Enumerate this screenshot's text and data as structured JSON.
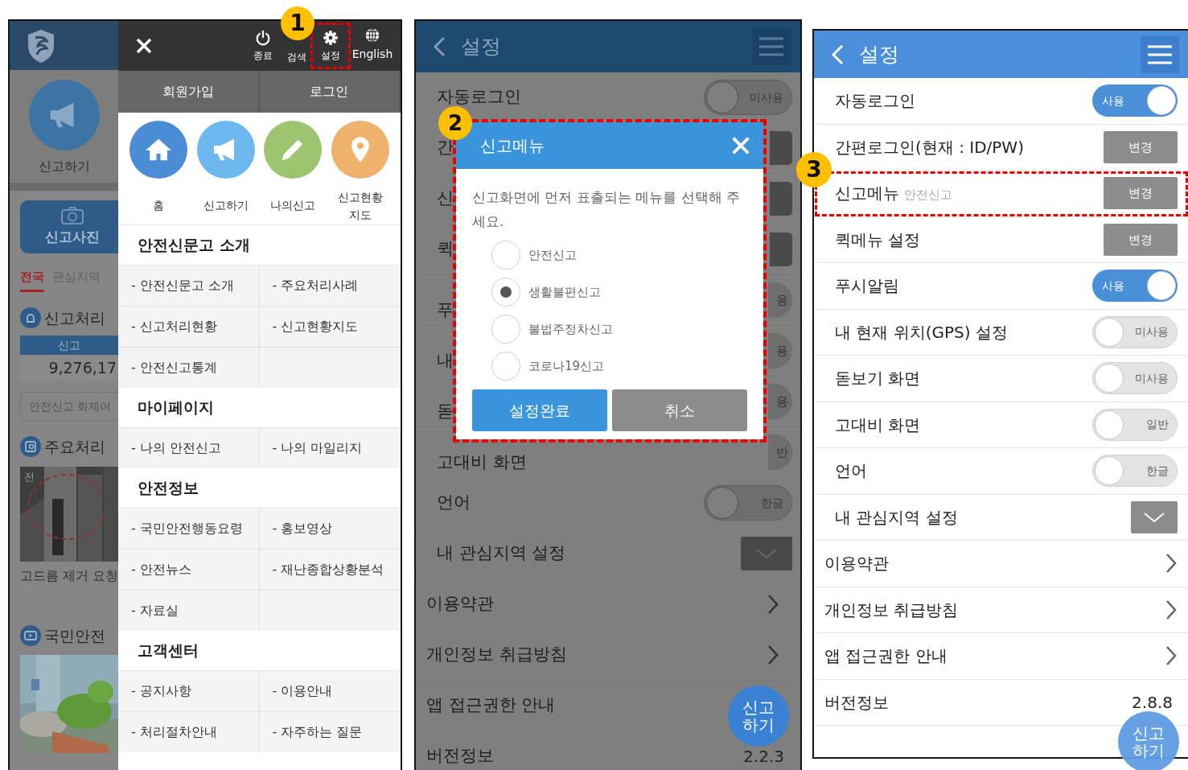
{
  "screen_1": {
    "callout": "1",
    "page": {
      "report_label": "신고하기",
      "photo_button": "신고사진",
      "region_tabs": [
        {
          "label": "전국",
          "selected": true
        },
        {
          "label": "관심지역",
          "selected": false
        }
      ],
      "status_title": "신고처리",
      "status_header": "신고",
      "status_count": "9,276,17",
      "keyword_box": "안전신고 화제어",
      "cases_title": "주요처리",
      "case_tag": "전",
      "case_caption": "고드름 제거 요청",
      "video_title": "국민안전"
    },
    "drawer": {
      "actions": [
        {
          "kind": "power",
          "label": "종료",
          "highlighted": false,
          "covered": false
        },
        {
          "kind": "search",
          "label": "검색",
          "highlighted": false,
          "covered": true
        },
        {
          "kind": "gear",
          "label": "설정",
          "highlighted": true,
          "covered": false
        },
        {
          "kind": "globe",
          "label": "English",
          "highlighted": false,
          "covered": false
        }
      ],
      "account_tabs": [
        "회원가입",
        "로그인"
      ],
      "shortcuts": [
        {
          "kind": "home",
          "label": "홈",
          "color": "#4a8dd6"
        },
        {
          "kind": "megaphone",
          "label": "신고하기",
          "color": "#6db8ee"
        },
        {
          "kind": "pencil",
          "label": "나의신고",
          "color": "#9dc56f"
        },
        {
          "kind": "pin",
          "label": "신고현황 지도",
          "color": "#eeb26c"
        }
      ],
      "sections": [
        {
          "title": "안전신문고 소개",
          "items": [
            "- 안전신문고 소개",
            "- 주요처리사례",
            "- 신고처리현황",
            "- 신고현황지도",
            "- 안전신고통계"
          ]
        },
        {
          "title": "마이페이지",
          "items": [
            "- 나의 안전신고",
            "- 나의 마일리지"
          ]
        },
        {
          "title": "안전정보",
          "items": [
            "- 국민안전행동요령",
            "- 홍보영상",
            "- 안전뉴스",
            "- 재난종합상황분석",
            "- 자료실"
          ]
        },
        {
          "title": "고객센터",
          "items": [
            "- 공지사항",
            "- 이용안내",
            "- 처리절차안내",
            "- 자주하는 질문"
          ]
        }
      ]
    }
  },
  "screen_2": {
    "callout": "2",
    "title": "설정",
    "rows": [
      {
        "label": "자동로그인",
        "kind": "toggle",
        "on": false,
        "value": "미사용"
      },
      {
        "label": "간",
        "kind": "covered_button"
      },
      {
        "label": "신",
        "kind": "covered_button"
      },
      {
        "label": "퀵",
        "kind": "covered_button"
      },
      {
        "label": "푸",
        "kind": "covered_toggle",
        "value": "용"
      },
      {
        "label": "내",
        "kind": "covered_toggle",
        "value": "용"
      },
      {
        "label": "돋",
        "kind": "covered_toggle",
        "value": "용"
      },
      {
        "label": "고대비 화면",
        "kind": "covered_toggle",
        "value": "반"
      },
      {
        "label": "언어",
        "kind": "toggle",
        "on": false,
        "value": "한글"
      },
      {
        "label": "내 관심지역 설정",
        "kind": "dropdown"
      },
      {
        "label": "이용약관",
        "kind": "link"
      },
      {
        "label": "개인정보 취급방침",
        "kind": "link"
      },
      {
        "label": "앱 접근권한 안내",
        "kind": "plain"
      },
      {
        "label": "버전정보",
        "kind": "version",
        "value": "2.2.3"
      }
    ],
    "dialog": {
      "title": "신고메뉴",
      "highlighted": true,
      "prompt": "신고화면에 먼저 표출되는 메뉴를 선택해 주세요.",
      "options": [
        {
          "label": "안전신고",
          "selected": false
        },
        {
          "label": "생활불편신고",
          "selected": true
        },
        {
          "label": "불법주정차신고",
          "selected": false
        },
        {
          "label": "코로나19신고",
          "selected": false
        }
      ],
      "buttons": [
        {
          "label": "설정완료",
          "kind": "primary"
        },
        {
          "label": "취소",
          "kind": "secondary"
        }
      ]
    },
    "fab": "신고 하기"
  },
  "screen_3": {
    "callout": "3",
    "title": "설정",
    "rows": [
      {
        "label": "자동로그인",
        "kind": "toggle",
        "on": true,
        "value": "사용"
      },
      {
        "label": "간편로그인(현재 : ID/PW)",
        "kind": "button",
        "button": "변경"
      },
      {
        "label": "신고메뉴",
        "sublabel": "안전신고",
        "kind": "button",
        "button": "변경",
        "highlighted": true
      },
      {
        "label": "퀵메뉴 설정",
        "kind": "button",
        "button": "변경"
      },
      {
        "label": "푸시알림",
        "kind": "toggle",
        "on": true,
        "value": "사용"
      },
      {
        "label": "내 현재 위치(GPS) 설정",
        "kind": "toggle",
        "on": false,
        "value": "미사용"
      },
      {
        "label": "돋보기 화면",
        "kind": "toggle",
        "on": false,
        "value": "미사용"
      },
      {
        "label": "고대비 화면",
        "kind": "toggle",
        "on": false,
        "value": "일반"
      },
      {
        "label": "언어",
        "kind": "toggle",
        "on": false,
        "value": "한글"
      },
      {
        "label": "내 관심지역 설정",
        "kind": "dropdown"
      },
      {
        "label": "이용약관",
        "kind": "link"
      },
      {
        "label": "개인정보 취급방침",
        "kind": "link"
      },
      {
        "label": "앱 접근권한 안내",
        "kind": "link"
      },
      {
        "label": "버전정보",
        "kind": "version",
        "value": "2.8.8"
      }
    ],
    "fab": "신고 하기"
  }
}
